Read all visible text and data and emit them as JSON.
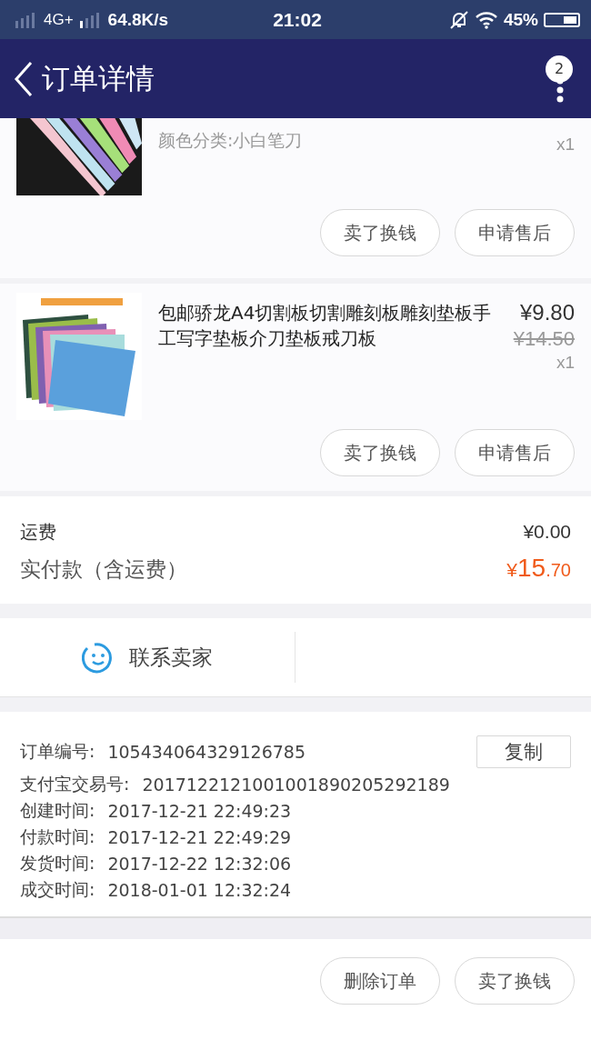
{
  "status_bar": {
    "network": "4G+",
    "speed": "64.8K/s",
    "time": "21:02",
    "battery": "45%"
  },
  "nav": {
    "title": "订单详情",
    "badge": "2"
  },
  "items": [
    {
      "variant": "颜色分类:小白笔刀",
      "quantity": "x1",
      "buttons": [
        "卖了换钱",
        "申请售后"
      ]
    },
    {
      "title": "包邮骄龙A4切割板切割雕刻板雕刻垫板手工写字垫板介刀垫板戒刀板",
      "price": "¥9.80",
      "original_price": "¥14.50",
      "quantity": "x1",
      "buttons": [
        "卖了换钱",
        "申请售后"
      ]
    }
  ],
  "fees": [
    {
      "label": "运费",
      "value": "¥0.00",
      "kind": "plain"
    },
    {
      "label": "实付款（含运费）",
      "value_main": "15",
      "value_decimals": ".70",
      "currency": "¥",
      "kind": "total"
    }
  ],
  "contact": {
    "label": "联系卖家"
  },
  "order_info": [
    {
      "label": "订单编号:",
      "value": "105434064329126785"
    },
    {
      "label": "支付宝交易号:",
      "value": "2017122121001001890205292189"
    },
    {
      "label": "创建时间:",
      "value": "2017-12-21 22:49:23"
    },
    {
      "label": "付款时间:",
      "value": "2017-12-21 22:49:29"
    },
    {
      "label": "发货时间:",
      "value": "2017-12-22 12:32:06"
    },
    {
      "label": "成交时间:",
      "value": "2018-01-01 12:32:24"
    }
  ],
  "copy_button": "复制",
  "bottom_buttons": [
    "删除订单",
    "卖了换钱"
  ]
}
